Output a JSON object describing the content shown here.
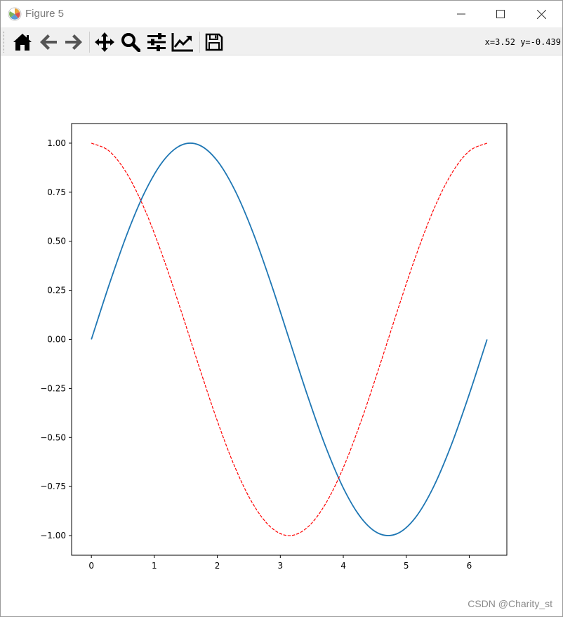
{
  "window": {
    "title": "Figure 5",
    "controls": [
      "minimize",
      "maximize",
      "close"
    ]
  },
  "toolbar": {
    "buttons": [
      {
        "name": "home",
        "icon": "home-icon"
      },
      {
        "name": "back",
        "icon": "arrow-left-icon"
      },
      {
        "name": "forward",
        "icon": "arrow-right-icon"
      },
      {
        "name": "pan",
        "icon": "move-icon"
      },
      {
        "name": "zoom",
        "icon": "magnifier-icon"
      },
      {
        "name": "configure-subplots",
        "icon": "sliders-icon"
      },
      {
        "name": "edit-axis",
        "icon": "line-chart-icon"
      },
      {
        "name": "save",
        "icon": "floppy-disk-icon"
      }
    ],
    "coordinates": "x=3.52 y=-0.439"
  },
  "watermark": "CSDN @Charity_st",
  "chart_data": {
    "type": "line",
    "title": "",
    "xlabel": "",
    "ylabel": "",
    "xlim": [
      -0.314,
      6.597
    ],
    "ylim": [
      -1.1,
      1.1
    ],
    "xticks": [
      "0",
      "1",
      "2",
      "3",
      "4",
      "5",
      "6"
    ],
    "yticks": [
      "−1.00",
      "−0.75",
      "−0.50",
      "−0.25",
      "0.00",
      "0.25",
      "0.50",
      "0.75",
      "1.00"
    ],
    "grid": false,
    "legend": "none",
    "x": [
      0,
      0.2856,
      0.5712,
      0.8568,
      1.1424,
      1.428,
      1.7136,
      1.9992,
      2.2848,
      2.5704,
      2.856,
      3.1416,
      3.4272,
      3.7128,
      3.9984,
      4.284,
      4.5696,
      4.8552,
      5.1408,
      5.4264,
      5.712,
      5.9976,
      6.2832
    ],
    "series": [
      {
        "color": "#1f77b4",
        "style": "solid",
        "values": [
          0,
          0.282,
          0.541,
          0.756,
          0.91,
          0.99,
          0.99,
          0.91,
          0.756,
          0.541,
          0.282,
          0,
          -0.282,
          -0.541,
          -0.756,
          -0.91,
          -0.99,
          -0.99,
          -0.91,
          -0.756,
          -0.541,
          -0.282,
          0
        ]
      },
      {
        "color": "#ff0000",
        "style": "dashed",
        "values": [
          1,
          0.959,
          0.841,
          0.655,
          0.415,
          0.142,
          -0.142,
          -0.415,
          -0.655,
          -0.841,
          -0.959,
          -1,
          -0.959,
          -0.841,
          -0.655,
          -0.415,
          -0.142,
          0.142,
          0.415,
          0.655,
          0.841,
          0.959,
          1
        ]
      }
    ]
  }
}
